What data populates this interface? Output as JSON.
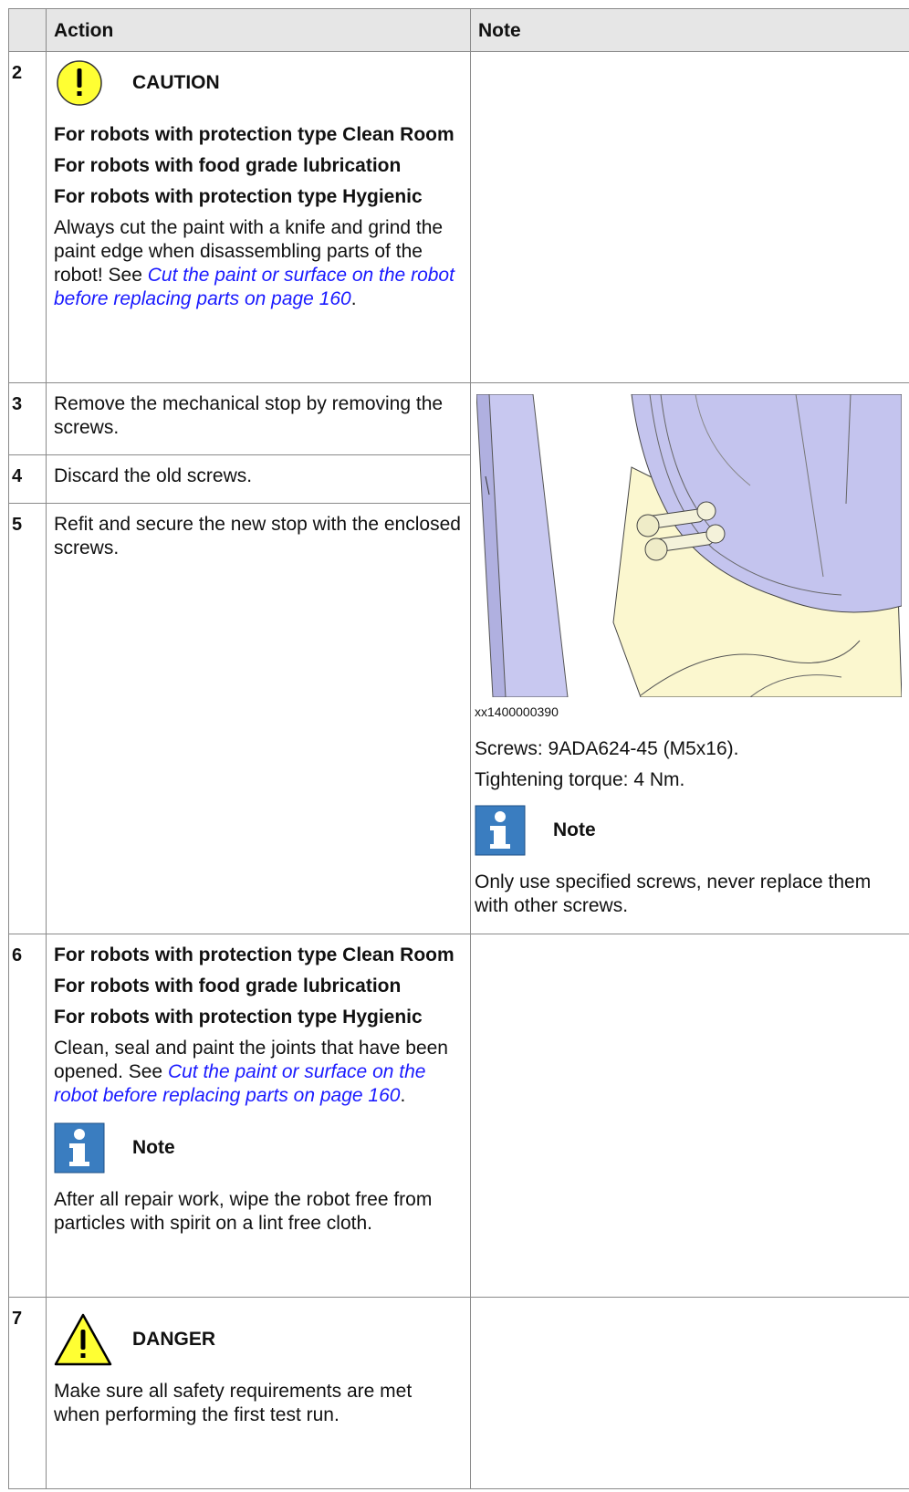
{
  "header": {
    "action": "Action",
    "note": "Note"
  },
  "steps": {
    "s2": {
      "num": "2",
      "caution_title": "CAUTION",
      "line1": "For robots with protection type Clean Room",
      "line2": "For robots with food grade lubrication",
      "line3": "For robots with protection type Hygienic",
      "body": "Always cut the paint with a knife and grind the paint edge when disassembling parts of the robot! See ",
      "link": "Cut the paint or surface on the robot before replacing parts on page 160",
      "tail": "."
    },
    "s3": {
      "num": "3",
      "text": "Remove the mechanical stop by removing the screws."
    },
    "s4": {
      "num": "4",
      "text": "Discard the old screws."
    },
    "s5": {
      "num": "5",
      "text": "Refit and secure the new stop with the enclosed screws."
    },
    "s6": {
      "num": "6",
      "line1": "For robots with protection type Clean Room",
      "line2": "For robots with food grade lubrication",
      "line3": "For robots with protection type Hygienic",
      "body": "Clean, seal and paint the joints that have been opened. See ",
      "link": "Cut the paint or surface on the robot before replacing parts on page 160",
      "tail": ".",
      "note_title": "Note",
      "note_text": "After all repair work, wipe the robot free from particles with spirit on a lint free cloth."
    },
    "s7": {
      "num": "7",
      "danger_title": "DANGER",
      "text": "Make sure all safety requirements are met when performing the first test run."
    }
  },
  "figure": {
    "id": "xx1400000390",
    "screws": "Screws: 9ADA624-45 (M5x16).",
    "torque": "Tightening torque: 4 Nm.",
    "note_title": "Note",
    "note_text": "Only use specified screws, never replace them with other screws."
  },
  "icons": {
    "caution": "caution-exclamation-icon",
    "info": "information-icon",
    "danger": "warning-triangle-icon"
  },
  "colors": {
    "caution_yellow": "#ffff33",
    "info_blue": "#3a7dc0",
    "link_blue": "#1a1aff"
  }
}
